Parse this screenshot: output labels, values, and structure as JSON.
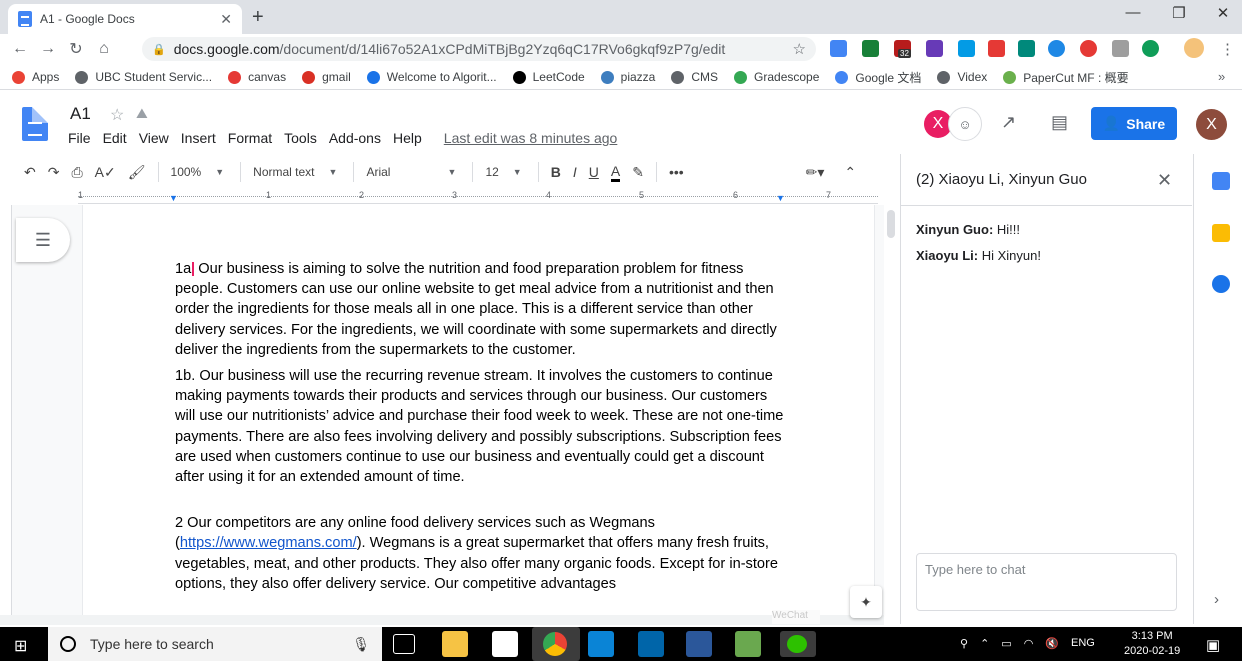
{
  "browser": {
    "tab_title": "A1 - Google Docs",
    "url_host": "docs.google.com",
    "url_path": "/document/d/14li67o52A1xCPdMiTBjBg2Yzq6qC17RVo6gkqf9zP7g/edit",
    "ext_badge": "32"
  },
  "bookmarks": [
    {
      "label": "Apps",
      "icon": "apps-grid-icon",
      "color": "#ea4335"
    },
    {
      "label": "UBC Student Servic...",
      "icon": "globe-icon",
      "color": "#5f6368"
    },
    {
      "label": "canvas",
      "icon": "canvas-icon",
      "color": "#e53935"
    },
    {
      "label": "gmail",
      "icon": "gmail-icon",
      "color": "#d93025"
    },
    {
      "label": "Welcome to Algorit...",
      "icon": "infinity-icon",
      "color": "#1a73e8"
    },
    {
      "label": "LeetCode",
      "icon": "leetcode-icon",
      "color": "#000000"
    },
    {
      "label": "piazza",
      "icon": "piazza-icon",
      "color": "#3e7ebf"
    },
    {
      "label": "CMS",
      "icon": "globe-icon",
      "color": "#5f6368"
    },
    {
      "label": "Gradescope",
      "icon": "bar-chart-icon",
      "color": "#34a853"
    },
    {
      "label": "Google 文档",
      "icon": "docs-icon",
      "color": "#4285f4"
    },
    {
      "label": "Videx",
      "icon": "videx-icon",
      "color": "#5f6368"
    },
    {
      "label": "PaperCut MF : 概要",
      "icon": "papercut-icon",
      "color": "#6ab04c"
    }
  ],
  "bookmarks_more": "»",
  "docs": {
    "title": "A1",
    "menus": [
      "File",
      "Edit",
      "View",
      "Insert",
      "Format",
      "Tools",
      "Add-ons",
      "Help"
    ],
    "last_edit": "Last edit was 8 minutes ago",
    "share_label": "Share",
    "avatar_letter": "X",
    "account_letter": "X"
  },
  "toolbar": {
    "zoom": "100%",
    "style": "Normal text",
    "font": "Arial",
    "size": "12",
    "bold": "B",
    "italic": "I",
    "underline": "U",
    "text_color": "A",
    "more": "•••"
  },
  "ruler": [
    "1",
    "1",
    "2",
    "3",
    "4",
    "5",
    "6",
    "7"
  ],
  "document": {
    "p1_marker": "1a",
    "p1": " Our business is aiming to solve the nutrition and food preparation problem for fitness people. Customers can use our online website to get meal advice from a nutritionist and then order the ingredients for those meals all in one place. This is a different service than other delivery services. For the ingredients, we will coordinate with some supermarkets and directly deliver the ingredients from the supermarkets to the customer.",
    "p2": "1b. Our business will use the recurring revenue stream. It involves the customers to continue making payments towards their products and services through our business. Our customers will use our nutritionists’ advice and purchase their food week to week. These are not one-time payments. There are also fees involving delivery and possibly subscriptions. Subscription fees are used when customers continue to use our business and eventually could get a discount after using it for an extended amount of time.",
    "p3_before": "2 Our competitors are any online food delivery services such as Wegmans (",
    "p3_link": "https://www.wegmans.com/",
    "p3_after": "). Wegmans is a great supermarket that offers many fresh fruits, vegetables, meat, and other products. They also offer many organic foods. Except for in-store options, they also offer delivery service. Our competitive advantages"
  },
  "chat": {
    "header": "(2) Xiaoyu Li, Xinyun Guo",
    "messages": [
      {
        "name": "Xinyun Guo:",
        "text": " Hi!!!"
      },
      {
        "name": "Xiaoyu Li:",
        "text": " Hi Xinyun!"
      }
    ],
    "input_placeholder": "Type here to chat",
    "faded_label": "WeChat"
  },
  "taskbar": {
    "search_placeholder": "Type here to search",
    "lang": "ENG",
    "time": "3:13 PM",
    "date": "2020-02-19"
  },
  "colors": {
    "accent": "#1a73e8",
    "avatar_pink": "#e91e63",
    "account": "#8d4c3c"
  }
}
